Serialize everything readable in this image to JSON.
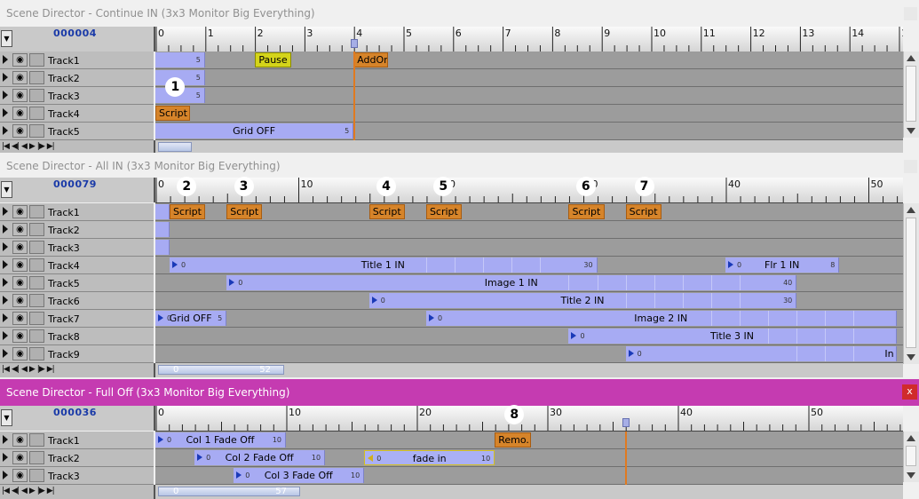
{
  "panels": [
    {
      "title": "Scene Director - Continue IN (3x3 Monitor Big Everything)",
      "counter": "000004",
      "active": false,
      "ruler": {
        "start": 0,
        "end": 15,
        "labels": [
          "0",
          "1",
          "2",
          "3",
          "4",
          "5",
          "6",
          "7",
          "8",
          "9",
          "10",
          "11",
          "12",
          "13",
          "14",
          "1"
        ]
      },
      "tracks": [
        "Track1",
        "Track2",
        "Track3",
        "Track4",
        "Track5"
      ],
      "clips": [
        {
          "track": 0,
          "start": 0,
          "end": 1,
          "label": "",
          "num_end": "5"
        },
        {
          "track": 1,
          "start": 0,
          "end": 1,
          "label": "",
          "num_end": "5"
        },
        {
          "track": 2,
          "start": 0,
          "end": 1,
          "label": "",
          "num_end": "5"
        },
        {
          "track": 4,
          "start": 0,
          "end": 4,
          "label": "Grid OFF",
          "num_end": "5"
        }
      ],
      "events": [
        {
          "track": 0,
          "start": 2,
          "end": 2.75,
          "label": "Pause",
          "kind": "pause"
        },
        {
          "track": 0,
          "start": 4,
          "end": 4.7,
          "label": "AddOn?",
          "kind": "script"
        },
        {
          "track": 3,
          "start": 0,
          "end": 0.7,
          "label": "Script",
          "kind": "script"
        }
      ],
      "markers": [
        {
          "label": "1",
          "at": 0.4,
          "track": 2
        }
      ],
      "playhead": 4,
      "hscroll_text": ""
    },
    {
      "title": "Scene Director - All IN (3x3 Monitor Big Everything)",
      "counter": "000079",
      "active": false,
      "ruler": {
        "start": 0,
        "end": 52,
        "labels": [
          "0",
          "10",
          "20",
          "30",
          "40",
          "50"
        ]
      },
      "tracks": [
        "Track1",
        "Track2",
        "Track3",
        "Track4",
        "Track5",
        "Track6",
        "Track7",
        "Track8",
        "Track9"
      ],
      "clips": [
        {
          "track": 3,
          "start": 1,
          "end": 31,
          "label": "Title 1 IN",
          "num_start": "0",
          "num_end": "30"
        },
        {
          "track": 3,
          "start": 40,
          "end": 48,
          "label": "Flr 1 IN",
          "num_start": "0",
          "num_end": "8"
        },
        {
          "track": 4,
          "start": 5,
          "end": 45,
          "label": "Image 1 IN",
          "num_start": "0",
          "num_end": "40"
        },
        {
          "track": 5,
          "start": 15,
          "end": 45,
          "label": "Title 2 IN",
          "num_start": "0",
          "num_end": "30"
        },
        {
          "track": 6,
          "start": 0,
          "end": 5,
          "label": "Grid OFF",
          "num_start": "0",
          "num_end": "5"
        },
        {
          "track": 6,
          "start": 19,
          "end": 52,
          "label": "Image 2 IN",
          "num_start": "0",
          "num_end": ""
        },
        {
          "track": 7,
          "start": 29,
          "end": 52,
          "label": "Title 3 IN",
          "num_start": "0",
          "num_end": ""
        },
        {
          "track": 8,
          "start": 33,
          "end": 52,
          "label": "In",
          "num_start": "0",
          "num_end": ""
        },
        {
          "track": 0,
          "start": 0,
          "end": 1,
          "label": "",
          "num_end": ""
        },
        {
          "track": 1,
          "start": 0,
          "end": 1,
          "label": "",
          "num_end": ""
        },
        {
          "track": 2,
          "start": 0,
          "end": 1,
          "label": "",
          "num_end": ""
        }
      ],
      "events": [
        {
          "track": 0,
          "start": 1,
          "end": 3.5,
          "label": "Script",
          "kind": "script"
        },
        {
          "track": 0,
          "start": 5,
          "end": 7.5,
          "label": "Script",
          "kind": "script"
        },
        {
          "track": 0,
          "start": 15,
          "end": 17.5,
          "label": "Script",
          "kind": "script"
        },
        {
          "track": 0,
          "start": 19,
          "end": 21.5,
          "label": "Script",
          "kind": "script"
        },
        {
          "track": 0,
          "start": 29,
          "end": 31.5,
          "label": "Script",
          "kind": "script"
        },
        {
          "track": 0,
          "start": 33,
          "end": 35.5,
          "label": "Script",
          "kind": "script"
        }
      ],
      "markers": [
        {
          "label": "2",
          "at": 2.2,
          "track": -1
        },
        {
          "label": "3",
          "at": 6.2,
          "track": -1
        },
        {
          "label": "4",
          "at": 16.2,
          "track": -1
        },
        {
          "label": "5",
          "at": 20.2,
          "track": -1
        },
        {
          "label": "6",
          "at": 30.2,
          "track": -1
        },
        {
          "label": "7",
          "at": 34.3,
          "track": -1
        }
      ],
      "playhead": null,
      "hscroll_text": "0 52"
    },
    {
      "title": "Scene Director - Full Off (3x3 Monitor Big Everything)",
      "counter": "000036",
      "active": true,
      "close_label": "x",
      "ruler": {
        "start": 0,
        "end": 57,
        "labels": [
          "0",
          "10",
          "20",
          "30",
          "40",
          "50"
        ]
      },
      "tracks": [
        "Track1",
        "Track2",
        "Track3"
      ],
      "clips": [
        {
          "track": 0,
          "start": 0,
          "end": 10,
          "label": "Col 1 Fade Off",
          "num_start": "0",
          "num_end": "10"
        },
        {
          "track": 1,
          "start": 3,
          "end": 13,
          "label": "Col 2 Fade Off",
          "num_start": "0",
          "num_end": "10"
        },
        {
          "track": 1,
          "start": 16,
          "end": 26,
          "label": "fade in",
          "num_start": "0",
          "num_end": "10",
          "style": "selected"
        },
        {
          "track": 2,
          "start": 6,
          "end": 16,
          "label": "Col 3 Fade Off",
          "num_start": "0",
          "num_end": "10"
        }
      ],
      "events": [
        {
          "track": 0,
          "start": 26,
          "end": 28.8,
          "label": "Remo...",
          "kind": "script"
        }
      ],
      "markers": [
        {
          "label": "8",
          "at": 27.5,
          "track": -1
        }
      ],
      "playhead": 36,
      "hscroll_text": "0 57"
    }
  ],
  "nav_buttons": [
    "first",
    "prev-frame",
    "play-back",
    "play",
    "next-frame",
    "last"
  ]
}
